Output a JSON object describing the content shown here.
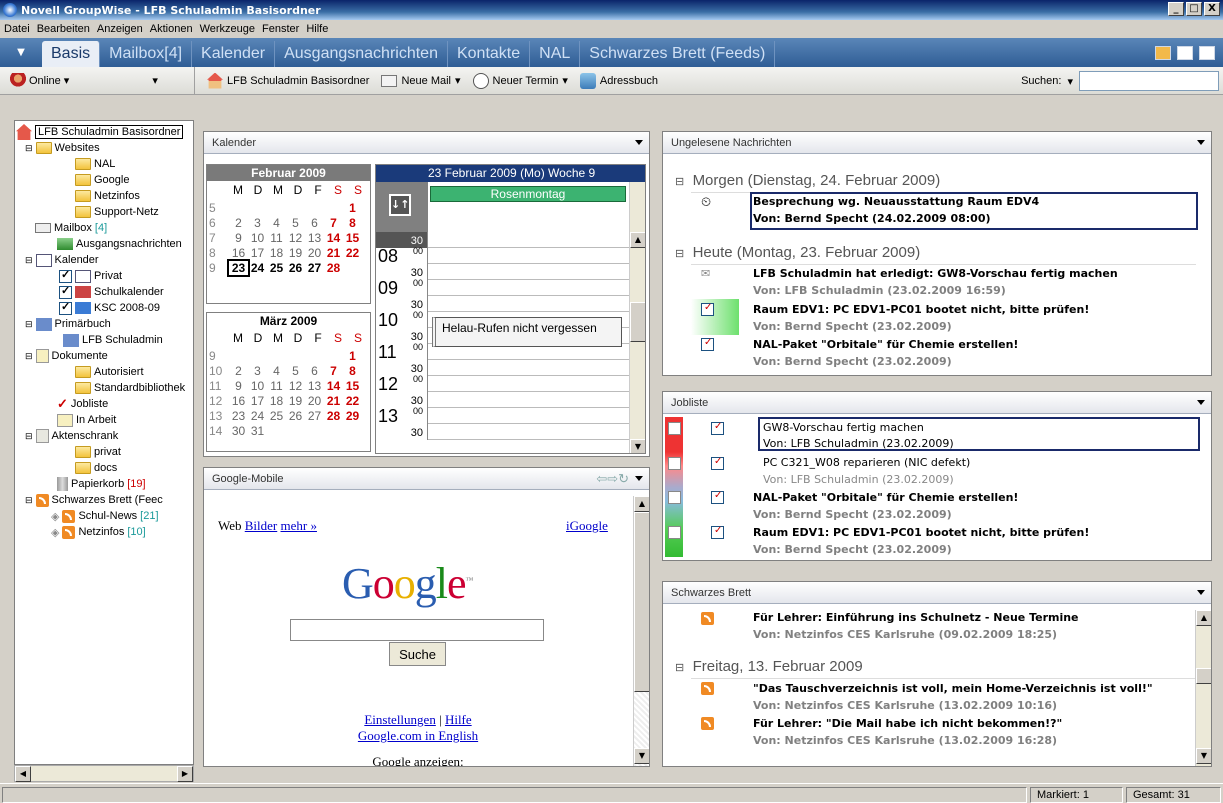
{
  "window": {
    "title": "Novell GroupWise - LFB Schuladmin Basisordner",
    "min": "_",
    "max": "□",
    "close": "X"
  },
  "menu": [
    "Datei",
    "Bearbeiten",
    "Anzeigen",
    "Aktionen",
    "Werkzeuge",
    "Fenster",
    "Hilfe"
  ],
  "tabs": [
    "Basis",
    "Mailbox[4]",
    "Kalender",
    "Ausgangsnachrichten",
    "Kontakte",
    "NAL",
    "Schwarzes Brett (Feeds)"
  ],
  "toolbar": {
    "online": "Online",
    "home": "LFB Schuladmin Basisordner",
    "new_mail": "Neue Mail",
    "new_appt": "Neuer Termin",
    "address_book": "Adressbuch",
    "search_label": "Suchen:"
  },
  "tree": {
    "root": "LFB Schuladmin Basisordner",
    "websites": "Websites",
    "nal": "NAL",
    "google": "Google",
    "netzinfos": "Netzinfos",
    "support": "Support-Netz",
    "mailbox": "Mailbox",
    "mailbox_count": "[4]",
    "ausgang": "Ausgangsnachrichten",
    "kalender": "Kalender",
    "privat": "Privat",
    "schulkalender": "Schulkalender",
    "ksc": "KSC 2008-09",
    "primaerbuch": "Primärbuch",
    "lfb": "LFB Schuladmin",
    "dokumente": "Dokumente",
    "autorisiert": "Autorisiert",
    "standardbib": "Standardbibliothek",
    "jobliste": "Jobliste",
    "inarbeit": "In Arbeit",
    "akten": "Aktenschrank",
    "akten_privat": "privat",
    "docs": "docs",
    "papierkorb": "Papierkorb",
    "papierkorb_count": "[19]",
    "brett": "Schwarzes Brett (Feec",
    "schulnews": "Schul-News",
    "schulnews_count": "[21]",
    "netzinfos2": "Netzinfos",
    "netzinfos2_count": "[10]"
  },
  "calendar": {
    "title": "Kalender",
    "feb_title": "Februar 2009",
    "mar_title": "März 2009",
    "weekdays": [
      "M",
      "D",
      "M",
      "D",
      "F",
      "S",
      "S"
    ],
    "feb_rows": [
      {
        "wk": "5",
        "days": [
          "",
          "",
          "",
          "",
          "",
          "",
          "1"
        ]
      },
      {
        "wk": "6",
        "days": [
          "2",
          "3",
          "4",
          "5",
          "6",
          "7",
          "8"
        ]
      },
      {
        "wk": "7",
        "days": [
          "9",
          "10",
          "11",
          "12",
          "13",
          "14",
          "15"
        ]
      },
      {
        "wk": "8",
        "days": [
          "16",
          "17",
          "18",
          "19",
          "20",
          "21",
          "22"
        ]
      },
      {
        "wk": "9",
        "days": [
          "23",
          "24",
          "25",
          "26",
          "27",
          "28",
          ""
        ]
      }
    ],
    "mar_rows": [
      {
        "wk": "9",
        "days": [
          "",
          "",
          "",
          "",
          "",
          "",
          "1"
        ]
      },
      {
        "wk": "10",
        "days": [
          "2",
          "3",
          "4",
          "5",
          "6",
          "7",
          "8"
        ]
      },
      {
        "wk": "11",
        "days": [
          "9",
          "10",
          "11",
          "12",
          "13",
          "14",
          "15"
        ]
      },
      {
        "wk": "12",
        "days": [
          "16",
          "17",
          "18",
          "19",
          "20",
          "21",
          "22"
        ]
      },
      {
        "wk": "13",
        "days": [
          "23",
          "24",
          "25",
          "26",
          "27",
          "28",
          "29"
        ]
      },
      {
        "wk": "14",
        "days": [
          "30",
          "31",
          "",
          "",
          "",
          "",
          ""
        ]
      }
    ],
    "day_header": "23 Februar 2009 (Mo) Woche 9",
    "all_day": "Rosenmontag",
    "hours": [
      "08",
      "09",
      "10",
      "11",
      "12",
      "13"
    ],
    "min00": "00",
    "min30": "30",
    "event": "Helau-Rufen nicht vergessen"
  },
  "google": {
    "panel_title": "Google-Mobile",
    "web": "Web",
    "bilder": "Bilder",
    "mehr": "mehr »",
    "igoogle": "iGoogle",
    "logo": "Google",
    "tm": "™",
    "search_btn": "Suche",
    "einst": "Einstellungen",
    "sep": "|",
    "hilfe": "Hilfe",
    "english": "Google.com in English",
    "anzeigen": "Google anzeigen:"
  },
  "unread": {
    "title": "Ungelesene Nachrichten",
    "group1": "Morgen (Dienstag, 24. Februar 2009)",
    "group2": "Heute (Montag, 23. Februar 2009)",
    "items": [
      {
        "subject": "Besprechung wg. Neuausstattung Raum EDV4",
        "from": "Von: Bernd Specht (24.02.2009 08:00)"
      },
      {
        "subject": "LFB Schuladmin hat erledigt: GW8-Vorschau fertig machen",
        "from": "Von: LFB Schuladmin (23.02.2009 16:59)"
      },
      {
        "subject": "Raum EDV1: PC EDV1-PC01 bootet nicht, bitte prüfen!",
        "from": "Von: Bernd Specht (23.02.2009)"
      },
      {
        "subject": "NAL-Paket \"Orbitale\" für Chemie erstellen!",
        "from": "Von: Bernd Specht (23.02.2009)"
      }
    ]
  },
  "jobs": {
    "title": "Jobliste",
    "items": [
      {
        "subject": "GW8-Vorschau fertig machen",
        "from": "Von: LFB Schuladmin (23.02.2009)"
      },
      {
        "subject": "PC C321_W08 reparieren (NIC defekt)",
        "from": "Von: LFB Schuladmin (23.02.2009)"
      },
      {
        "subject": "NAL-Paket \"Orbitale\" für Chemie erstellen!",
        "from": "Von: Bernd Specht (23.02.2009)"
      },
      {
        "subject": "Raum EDV1: PC EDV1-PC01 bootet nicht, bitte prüfen!",
        "from": "Von: Bernd Specht (23.02.2009)"
      }
    ]
  },
  "board": {
    "title": "Schwarzes Brett",
    "group": "Freitag, 13. Februar 2009",
    "items": [
      {
        "subject": "Für Lehrer: Einführung ins Schulnetz - Neue Termine",
        "from": "Von: Netzinfos CES Karlsruhe (09.02.2009 18:25)"
      },
      {
        "subject": "\"Das Tauschverzeichnis ist voll, mein Home-Verzeichnis ist voll!\"",
        "from": "Von: Netzinfos CES Karlsruhe (13.02.2009 10:16)"
      },
      {
        "subject": "Für Lehrer: \"Die Mail habe ich nicht bekommen!?\"",
        "from": "Von: Netzinfos CES Karlsruhe (13.02.2009 16:28)"
      }
    ]
  },
  "status": {
    "markiert": "Markiert: 1",
    "gesamt": "Gesamt: 31"
  }
}
